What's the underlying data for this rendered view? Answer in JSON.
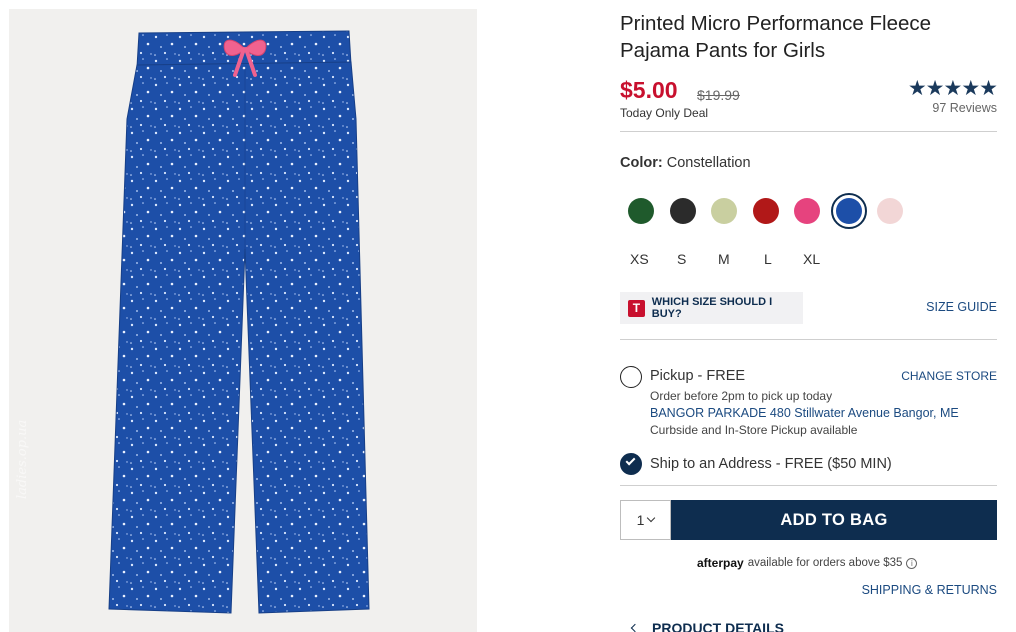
{
  "product": {
    "title": "Printed Micro Performance Fleece Pajama Pants for Girls",
    "price": "$5.00",
    "original_price": "$19.99",
    "deal_label": "Today Only Deal",
    "rating": 4.5,
    "stars": "★★★★★",
    "reviews": "97 Reviews",
    "image_watermark": "ladies.op.ua"
  },
  "color": {
    "label": "Color:",
    "selected": "Constellation",
    "swatches": [
      {
        "name": "green-trees",
        "color": "#1f5a2c"
      },
      {
        "name": "dark-reindeer",
        "color": "#2b2b2b"
      },
      {
        "name": "green-plaid",
        "color": "#c9cfa0"
      },
      {
        "name": "red-buffalo-check",
        "color": "#b11818"
      },
      {
        "name": "pink-penguin",
        "color": "#e6437e"
      },
      {
        "name": "constellation",
        "color": "#1d4fa8",
        "selected": true
      },
      {
        "name": "candy-cane",
        "color": "#f2d6d6"
      }
    ]
  },
  "sizes": [
    "XS",
    "S",
    "M",
    "L",
    "XL"
  ],
  "size_help": {
    "logo": "T",
    "label": "WHICH SIZE SHOULD I BUY?",
    "guide": "SIZE GUIDE"
  },
  "fulfillment": {
    "pickup_label": "Pickup - FREE",
    "change_store": "CHANGE STORE",
    "pickup_note": "Order before 2pm to pick up today",
    "store_address": "BANGOR PARKADE 480 Stillwater Avenue  Bangor, ME",
    "pickup_avail": "Curbside and In-Store Pickup available",
    "ship_label": "Ship to an Address - FREE ($50 MIN)"
  },
  "cart": {
    "qty": "1",
    "add_label": "ADD TO BAG"
  },
  "afterpay": {
    "logo": "afterpay",
    "text": "available for orders above $35",
    "info": "i"
  },
  "links": {
    "shipping": "SHIPPING & RETURNS",
    "product_details": "PRODUCT DETAILS"
  },
  "colors": {
    "navy": "#0e2d4f",
    "sale_red": "#c8102e",
    "link_blue": "#1b4a80",
    "pants_blue": "#1d4fa8"
  }
}
